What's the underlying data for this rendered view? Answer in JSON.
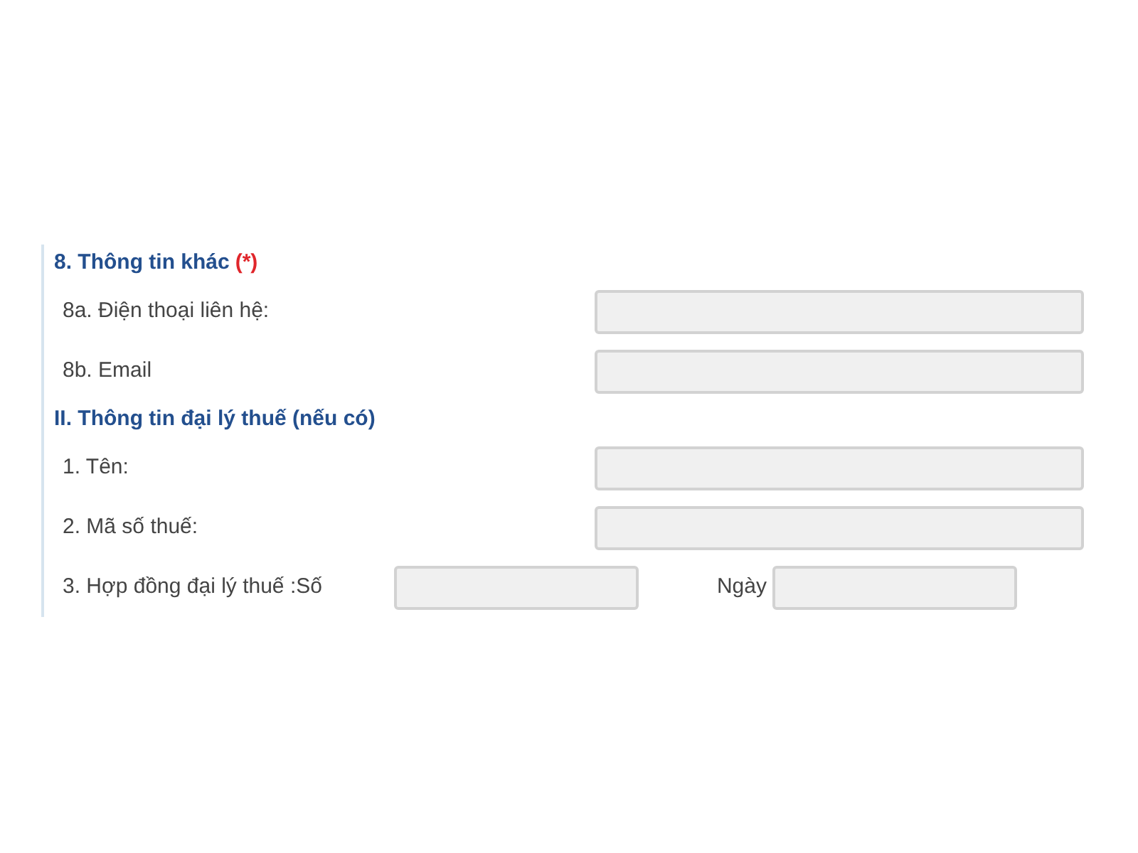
{
  "sections": [
    {
      "title": "8. Thông tin khác",
      "required_mark": "(*)",
      "rows": [
        {
          "kind": "field",
          "label": "8a. Điện thoại liên hệ:"
        },
        {
          "kind": "field",
          "label": "8b. Email"
        }
      ]
    },
    {
      "title": "II. Thông tin đại lý thuế (nếu có)",
      "rows": [
        {
          "kind": "field",
          "label": "1. Tên:"
        },
        {
          "kind": "field",
          "label": "2. Mã số thuế:"
        },
        {
          "kind": "contract",
          "label": "3. Hợp đồng đại lý thuế :Số",
          "date_label": "Ngày"
        }
      ]
    }
  ]
}
